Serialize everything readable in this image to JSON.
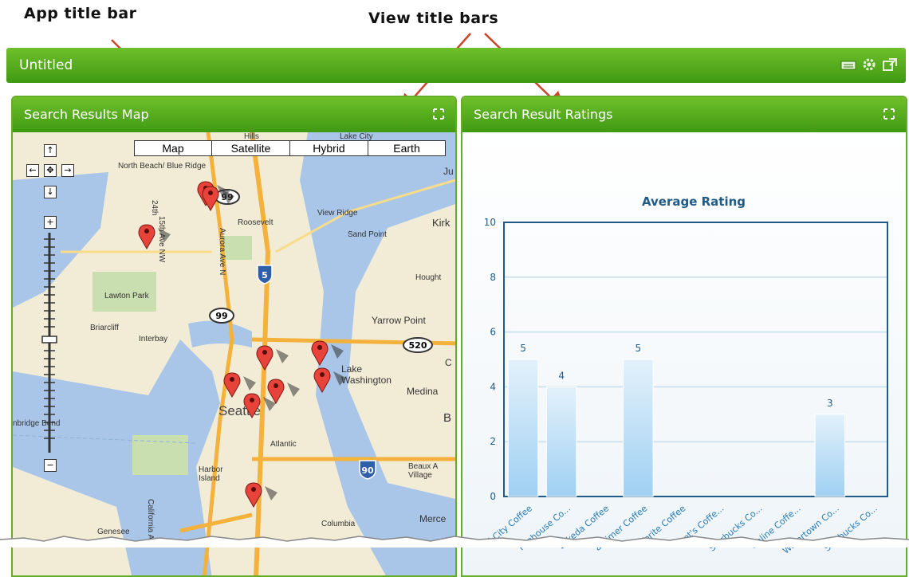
{
  "annotations": {
    "app_title_bar": "App title bar",
    "view_title_bars": "View title bars"
  },
  "app": {
    "title": "Untitled"
  },
  "map_view": {
    "title": "Search Results Map",
    "map_types": [
      "Map",
      "Satellite",
      "Hybrid",
      "Earth"
    ],
    "place_labels": [
      "North Beach/\nBlue Ridge",
      "Roosevelt",
      "View Ridge",
      "Sand Point",
      "Kirk",
      "Hought",
      "Lawton Park",
      "Briarcliff",
      "Interbay",
      "Yarrow Point",
      "Lake\nWashington",
      "Medina",
      "Seattle",
      "Atlantic",
      "Harbor\nIsland",
      "Beaux A\nVillage",
      "Columbia",
      "Merce",
      "Genesee",
      "Hills",
      "Lake City",
      "15th Ave NW",
      "Aurora Ave N",
      "24th",
      "nbridge Bend",
      "California Av",
      "B",
      "C",
      "Ju"
    ],
    "road_shields": [
      "99",
      "5",
      "99",
      "520",
      "90"
    ],
    "icons": [
      "pan-up-icon",
      "pan-left-icon",
      "pan-center-icon",
      "pan-right-icon",
      "pan-down-icon",
      "zoom-in-icon",
      "zoom-out-icon",
      "map-pin-icon"
    ]
  },
  "chart_view": {
    "title": "Search Result Ratings",
    "chart_data": {
      "type": "bar",
      "title": "Average Rating",
      "categories": [
        "ll City Coffee",
        "Firehouse Co...",
        "Lakeda Coffee",
        "arkimer Coffee",
        "Verite Coffee",
        "et's Coffe...",
        "Starbucks Co...",
        "Online Coffe...",
        "Watertown Co...",
        "Starbucks Co..."
      ],
      "values": [
        5,
        4,
        0,
        5,
        0,
        0,
        0,
        0,
        3,
        0
      ],
      "data_labels": [
        "5",
        "4",
        "",
        "5",
        "",
        "",
        "",
        "",
        "3",
        ""
      ],
      "ylim": [
        0,
        10
      ],
      "yticks": [
        "0",
        "2",
        "4",
        "6",
        "8",
        "10"
      ],
      "grid": true,
      "colors": {
        "bar_top": "#ffffff",
        "bar_bottom": "#9fd0f2",
        "axis": "#1f5b86"
      }
    }
  },
  "colors": {
    "title_bar_green": "#4ea81a",
    "annotation_arrow": "#c8462a"
  }
}
